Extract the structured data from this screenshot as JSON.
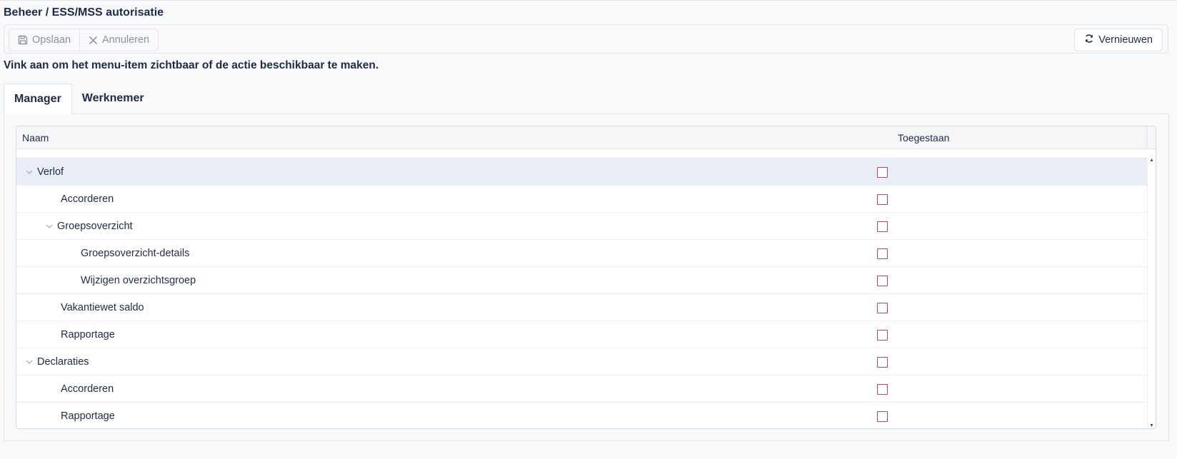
{
  "page": {
    "title": "Beheer / ESS/MSS autorisatie"
  },
  "toolbar": {
    "save_label": "Opslaan",
    "cancel_label": "Annuleren",
    "refresh_label": "Vernieuwen"
  },
  "instruction": "Vink aan om het menu-item zichtbaar of de actie beschikbaar te maken.",
  "tabs": [
    {
      "label": "Manager",
      "active": true
    },
    {
      "label": "Werknemer",
      "active": false
    }
  ],
  "grid": {
    "columns": {
      "name": "Naam",
      "allowed": "Toegestaan"
    },
    "rows": [
      {
        "label": "Verlof",
        "level": 0,
        "expandable": true,
        "checked": false,
        "selected": true
      },
      {
        "label": "Accorderen",
        "level": 1,
        "expandable": false,
        "checked": false
      },
      {
        "label": "Groepsoverzicht",
        "level": 1,
        "expandable": true,
        "checked": false
      },
      {
        "label": "Groepsoverzicht-details",
        "level": 2,
        "expandable": false,
        "checked": false
      },
      {
        "label": "Wijzigen overzichtsgroep",
        "level": 2,
        "expandable": false,
        "checked": false
      },
      {
        "label": "Vakantiewet saldo",
        "level": 1,
        "expandable": false,
        "checked": false
      },
      {
        "label": "Rapportage",
        "level": 1,
        "expandable": false,
        "checked": false
      },
      {
        "label": "Declaraties",
        "level": 0,
        "expandable": true,
        "checked": false
      },
      {
        "label": "Accorderen",
        "level": 1,
        "expandable": false,
        "checked": false
      },
      {
        "label": "Rapportage",
        "level": 1,
        "expandable": false,
        "checked": false
      }
    ]
  },
  "colors": {
    "checkbox_border": "#b8436a",
    "selected_row": "#e9eef6",
    "text": "#1f2a44"
  }
}
